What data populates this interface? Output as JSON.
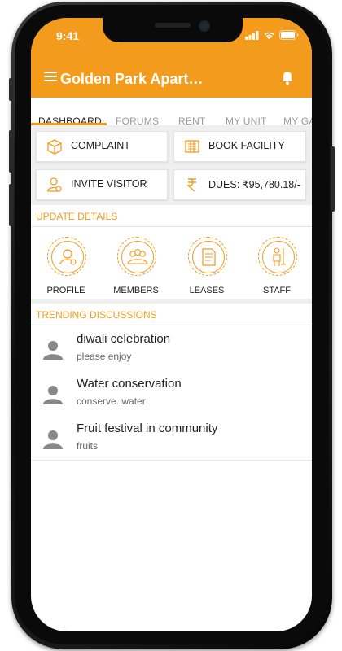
{
  "status_bar": {
    "time": "9:41"
  },
  "app_bar": {
    "title": "Golden Park Apart…"
  },
  "tabs": [
    {
      "label": "DASHBOARD",
      "active": true
    },
    {
      "label": "FORUMS",
      "active": false
    },
    {
      "label": "RENT",
      "active": false
    },
    {
      "label": "MY UNIT",
      "active": false
    },
    {
      "label": "MY GA",
      "active": false
    }
  ],
  "quick_actions": [
    {
      "label": "COMPLAINT",
      "icon": "box-icon"
    },
    {
      "label": "BOOK FACILITY",
      "icon": "facility-icon"
    },
    {
      "label": "INVITE VISITOR",
      "icon": "visitor-icon"
    },
    {
      "label": "DUES: ₹95,780.18/-",
      "icon": "rupee-icon"
    }
  ],
  "update_details": {
    "title": "UPDATE DETAILS",
    "items": [
      {
        "label": "PROFILE",
        "icon": "profile-icon"
      },
      {
        "label": "MEMBERS",
        "icon": "members-icon"
      },
      {
        "label": "LEASES",
        "icon": "lease-document-icon"
      },
      {
        "label": "STAFF",
        "icon": "staff-icon"
      }
    ]
  },
  "trending": {
    "title": "TRENDING DISCUSSIONS",
    "items": [
      {
        "title": "diwali celebration",
        "subtitle": "please enjoy"
      },
      {
        "title": "Water conservation",
        "subtitle": "conserve. water"
      },
      {
        "title": "Fruit festival in community",
        "subtitle": "fruits"
      }
    ]
  },
  "colors": {
    "accent": "#f39b1c",
    "phone": "#111111"
  }
}
